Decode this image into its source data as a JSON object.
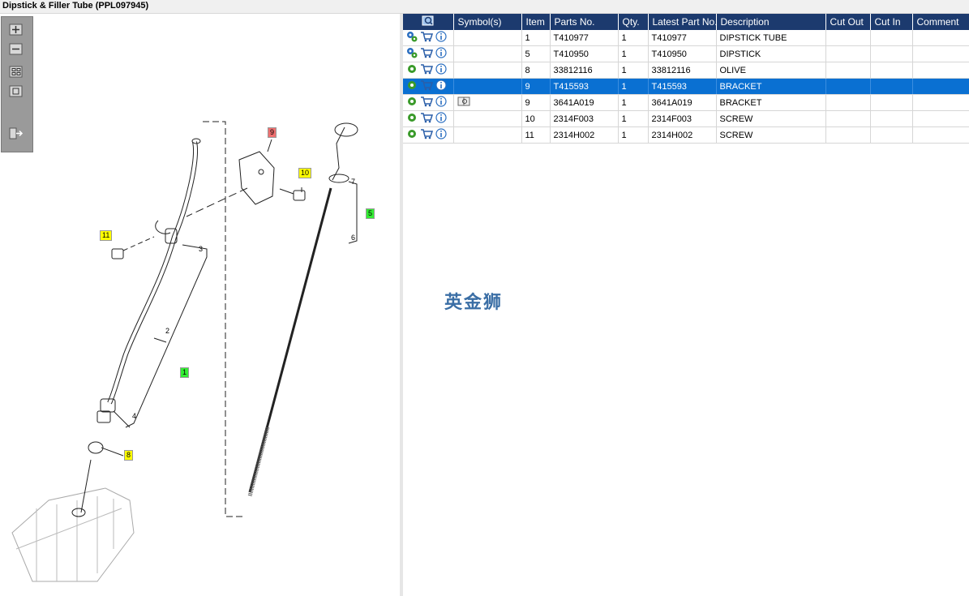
{
  "window": {
    "title": "Dipstick & Filler Tube (PPL097945)"
  },
  "toolbar": {
    "buttons": [
      {
        "name": "zoom-in",
        "icon": "plus-icon"
      },
      {
        "name": "zoom-out",
        "icon": "minus-icon"
      },
      {
        "name": "fit-all",
        "icon": "fit-icon"
      },
      {
        "name": "fit-window",
        "icon": "window-icon"
      },
      {
        "name": "export",
        "icon": "export-icon"
      }
    ]
  },
  "diagram": {
    "callouts": [
      {
        "label": "9",
        "style": "red"
      },
      {
        "label": "10",
        "style": "yellow"
      },
      {
        "label": "11",
        "style": "yellow"
      },
      {
        "label": "5",
        "style": "green"
      },
      {
        "label": "1",
        "style": "green"
      },
      {
        "label": "8",
        "style": "yellow"
      }
    ],
    "part_numbers": [
      "7",
      "6",
      "3",
      "2",
      "4"
    ]
  },
  "parts_table": {
    "columns": [
      "Symbol(s)",
      "Item",
      "Parts No.",
      "Qty.",
      "Latest Part No.",
      "Description",
      "Cut Out",
      "Cut In",
      "Comment"
    ],
    "rows": [
      {
        "item": "1",
        "part_no": "T410977",
        "qty": "1",
        "latest": "T410977",
        "description": "DIPSTICK TUBE",
        "gear": "double",
        "symbol": ""
      },
      {
        "item": "5",
        "part_no": "T410950",
        "qty": "1",
        "latest": "T410950",
        "description": "DIPSTICK",
        "gear": "double",
        "symbol": ""
      },
      {
        "item": "8",
        "part_no": "33812116",
        "qty": "1",
        "latest": "33812116",
        "description": "OLIVE",
        "gear": "single",
        "symbol": ""
      },
      {
        "item": "9",
        "part_no": "T415593",
        "qty": "1",
        "latest": "T415593",
        "description": "BRACKET",
        "gear": "single",
        "symbol": "",
        "selected": true
      },
      {
        "item": "9",
        "part_no": "3641A019",
        "qty": "1",
        "latest": "3641A019",
        "description": "BRACKET",
        "gear": "single",
        "symbol": "book-icon"
      },
      {
        "item": "10",
        "part_no": "2314F003",
        "qty": "1",
        "latest": "2314F003",
        "description": "SCREW",
        "gear": "single",
        "symbol": ""
      },
      {
        "item": "11",
        "part_no": "2314H002",
        "qty": "1",
        "latest": "2314H002",
        "description": "SCREW",
        "gear": "single",
        "symbol": ""
      }
    ]
  },
  "watermark": "英金狮",
  "colors": {
    "header_bg": "#1c3a6e",
    "selected_row": "#0a70d2",
    "gear": "#3a9a2a",
    "cart": "#2a5ea8"
  }
}
